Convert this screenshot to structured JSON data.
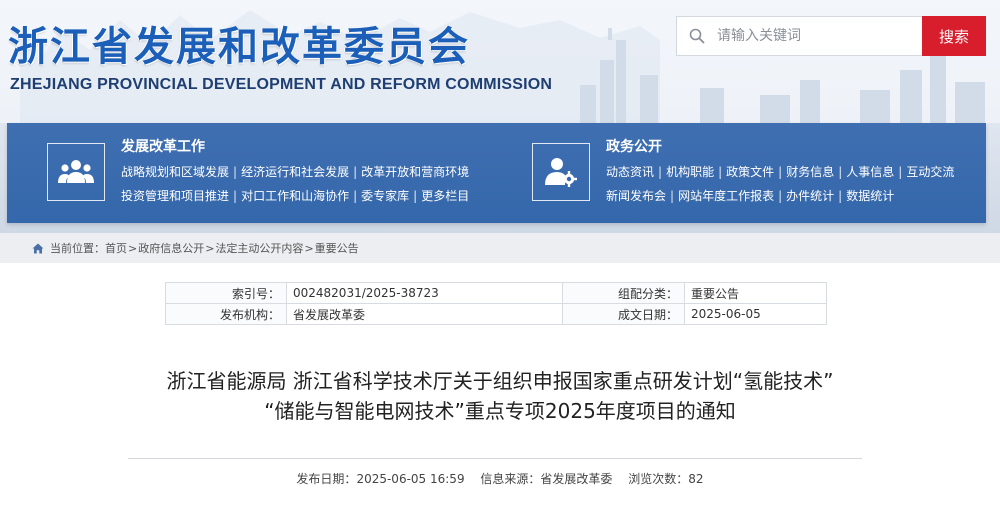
{
  "header": {
    "title": "浙江省发展和改革委员会",
    "subtitle": "ZHEJIANG PROVINCIAL DEVELOPMENT AND REFORM COMMISSION",
    "brand_color": "#1b5fb8"
  },
  "search": {
    "icon": "search-icon",
    "placeholder": "请输入关键词",
    "button_label": "搜索",
    "button_color": "#d81e2c"
  },
  "nav": {
    "panel_color": "#3a6aae",
    "blocks": [
      {
        "icon": "users-icon",
        "heading": "发展改革工作",
        "rows": [
          [
            "战略规划和区域发展",
            "经济运行和社会发展",
            "改革开放和营商环境"
          ],
          [
            "投资管理和项目推进",
            "对口工作和山海协作",
            "委专家库",
            "更多栏目"
          ]
        ]
      },
      {
        "icon": "user-gear-icon",
        "heading": "政务公开",
        "rows": [
          [
            "动态资讯",
            "机构职能",
            "政策文件",
            "财务信息",
            "人事信息",
            "互动交流"
          ],
          [
            "新闻发布会",
            "网站年度工作报表",
            "办件统计",
            "数据统计"
          ]
        ]
      }
    ]
  },
  "breadcrumb": {
    "icon": "home-icon",
    "prefix": "当前位置：",
    "items": [
      "首页",
      "政府信息公开",
      "法定主动公开内容",
      "重要公告"
    ],
    "separator": ">"
  },
  "meta": {
    "rows": [
      {
        "k1": "索引号：",
        "v1": "002482031/2025-38723",
        "k2": "组配分类：",
        "v2": "重要公告"
      },
      {
        "k1": "发布机构：",
        "v1": "省发展改革委",
        "k2": "成文日期：",
        "v2": "2025-06-05"
      }
    ]
  },
  "article": {
    "title_line1": "浙江省能源局 浙江省科学技术厅关于组织申报国家重点研发计划“氢能技术”",
    "title_line2": "“储能与智能电网技术”重点专项2025年度项目的通知",
    "publish_label": "发布日期：",
    "publish_date": "2025-06-05 16:59",
    "source_label": "信息来源：",
    "source": "省发展改革委",
    "views_label": "浏览次数：",
    "views": "82"
  }
}
